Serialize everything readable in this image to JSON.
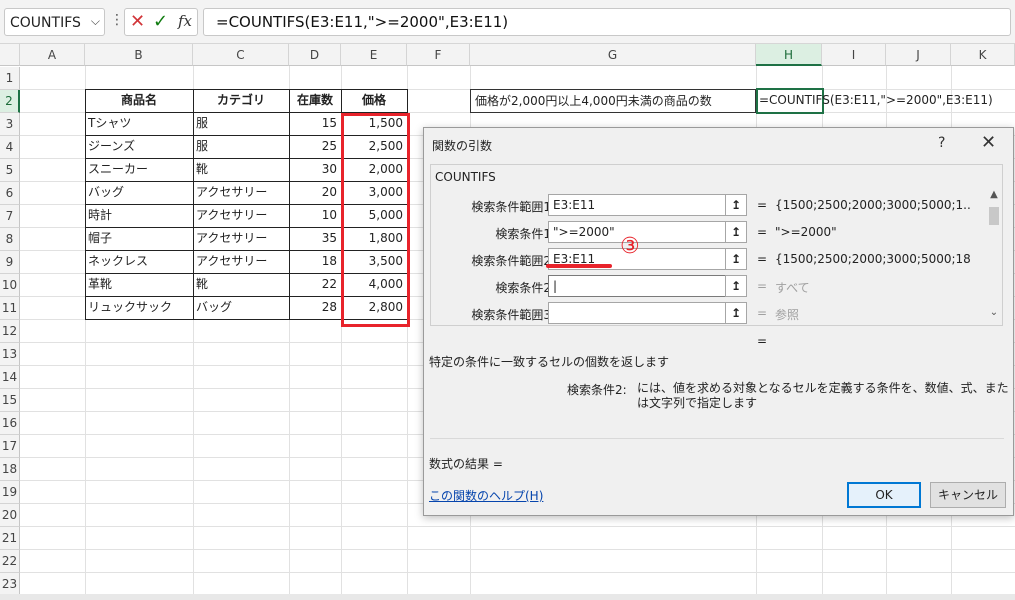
{
  "formula_bar": {
    "name_box": "COUNTIFS",
    "dots": "⋮",
    "cancel_icon": "✕",
    "enter_icon": "✓",
    "fx_label": "fx",
    "formula": "=COUNTIFS(E3:E11,\">=2000\",E3:E11)"
  },
  "sheet": {
    "columns": [
      "A",
      "B",
      "C",
      "D",
      "E",
      "F",
      "G",
      "H",
      "I",
      "J",
      "K"
    ],
    "rows": [
      "1",
      "2",
      "3",
      "4",
      "5",
      "6",
      "7",
      "8",
      "9",
      "10",
      "11",
      "12",
      "13",
      "14",
      "15",
      "16",
      "17",
      "18",
      "19",
      "20",
      "21",
      "22",
      "23"
    ],
    "selected_column": "H",
    "selected_row": "2",
    "table": {
      "headers": [
        "商品名",
        "カテゴリ",
        "在庫数",
        "価格"
      ],
      "rows": [
        [
          "Tシャツ",
          "服",
          "15",
          "1,500"
        ],
        [
          "ジーンズ",
          "服",
          "25",
          "2,500"
        ],
        [
          "スニーカー",
          "靴",
          "30",
          "2,000"
        ],
        [
          "バッグ",
          "アクセサリー",
          "20",
          "3,000"
        ],
        [
          "時計",
          "アクセサリー",
          "10",
          "5,000"
        ],
        [
          "帽子",
          "アクセサリー",
          "35",
          "1,800"
        ],
        [
          "ネックレス",
          "アクセサリー",
          "18",
          "3,500"
        ],
        [
          "革靴",
          "靴",
          "22",
          "4,000"
        ],
        [
          "リュックサック",
          "バッグ",
          "28",
          "2,800"
        ]
      ]
    },
    "g2_label": "価格が2,000円以上4,000円未満の商品の数",
    "h2_formula": "=COUNTIFS(E3:E11,\">=2000\",E3:E11)"
  },
  "dialog": {
    "title": "関数の引数",
    "help_icon": "?",
    "close_icon": "✕",
    "function_name": "COUNTIFS",
    "args": [
      {
        "label": "検索条件範囲1",
        "value": "E3:E11",
        "eq": "=",
        "result": "{1500;2500;2000;3000;5000;1...",
        "dim": false
      },
      {
        "label": "検索条件1",
        "value": "\">=2000\"",
        "eq": "=",
        "result": "\">=2000\"",
        "dim": false
      },
      {
        "label": "検索条件範囲2",
        "value": "E3:E11",
        "eq": "=",
        "result": "{1500;2500;2000;3000;5000;1800",
        "dim": false
      },
      {
        "label": "検索条件2",
        "value": "",
        "eq": "=",
        "result": "すべて",
        "dim": true
      },
      {
        "label": "検索条件範囲3",
        "value": "",
        "eq": "=",
        "result": "参照",
        "dim": true
      }
    ],
    "ref_icon": "↥",
    "scroll_up": "▲",
    "scroll_down": "⌄",
    "overall_eq": "=",
    "description": "特定の条件に一致するセルの個数を返します",
    "arg_desc_label": "検索条件2:",
    "arg_desc_text": "には、値を求める対象となるセルを定義する条件を、数値、式、または文字列で指定します",
    "result_label": "数式の結果 =",
    "help_link": "この関数のヘルプ(H)",
    "ok_label": "OK",
    "cancel_label": "キャンセル"
  },
  "annotation": {
    "step_marker": "③",
    "color": "#e8232b"
  }
}
